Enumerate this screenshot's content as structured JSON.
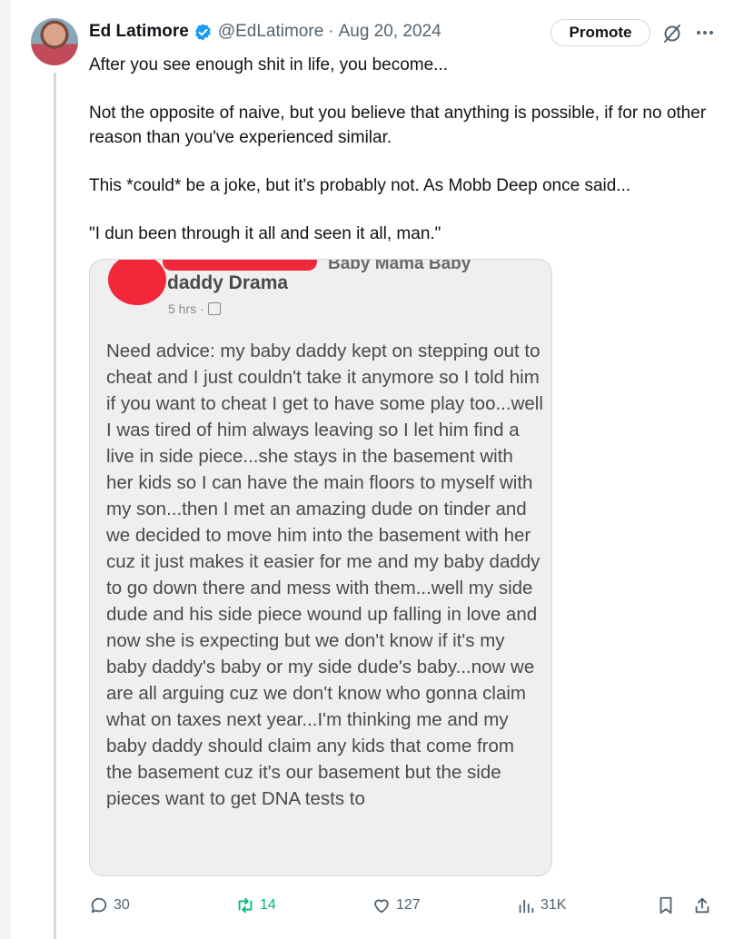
{
  "tweet": {
    "author_name": "Ed Latimore",
    "handle": "@EdLatimore",
    "separator": "·",
    "date": "Aug 20, 2024",
    "promote_label": "Promote",
    "paragraphs": [
      "After you see enough shit in life, you become...",
      "Not the opposite of naive, but you believe that anything is possible, if for no other reason than you've experienced similar.",
      "This *could* be a joke, but it's probably not. As Mobb Deep once said...",
      "\"I dun been through it all and seen it all, man.\""
    ]
  },
  "media": {
    "cut_title": "Baby Mama Baby",
    "group_name": "daddy Drama",
    "time": "5 hrs",
    "dot": "·",
    "body": "Need advice: my baby daddy kept on stepping out to cheat and I just couldn't take it anymore so I told him if you want to cheat I get to have some play too...well I was tired of him always leaving so I let him find a live in side piece...she stays in the basement with her kids so I can have the main floors to myself with my son...then I met an amazing dude on tinder and we decided to move him into the basement with her cuz it just makes it easier for me and my baby daddy to go down there and mess with them...well my side dude and his side piece wound up falling in love and now she is expecting but we don't know if it's my baby daddy's baby or my side dude's baby...now we are all arguing cuz we don't know who gonna claim what on taxes next year...I'm thinking me and my baby daddy should claim any kids that come from the basement cuz it's our basement but the side pieces want to get DNA tests to"
  },
  "actions": {
    "replies": "30",
    "retweets": "14",
    "likes": "127",
    "views": "31K"
  },
  "colors": {
    "verified_blue": "#1d9bf0",
    "retweet_green": "#00ba7c",
    "muted_gray": "#536471"
  }
}
